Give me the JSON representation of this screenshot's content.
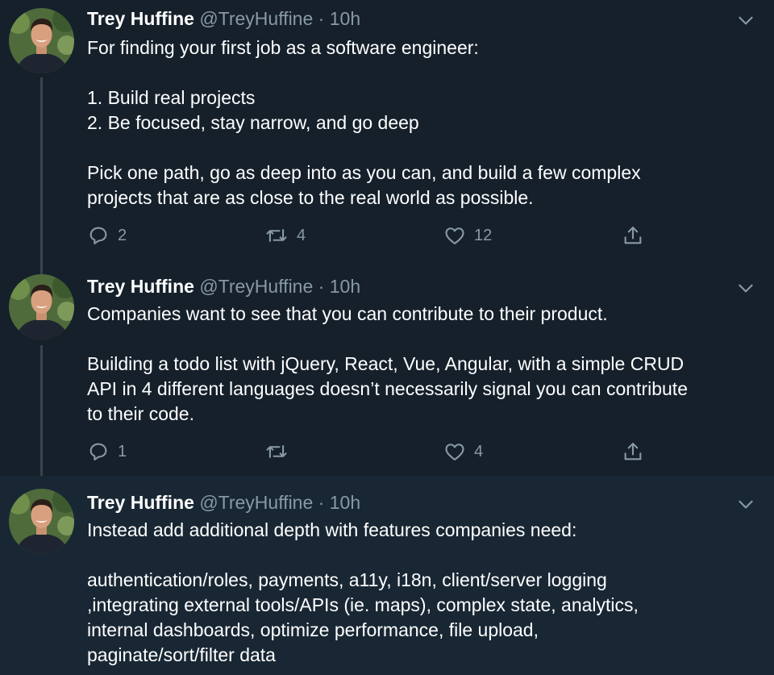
{
  "tweets": [
    {
      "name": "Trey Huffine",
      "handle": "@TreyHuffine",
      "separator": "·",
      "time": "10h",
      "lines": [
        "For finding your first job as a software engineer:",
        "",
        "1. Build real projects",
        "2. Be focused, stay narrow, and go deep",
        "",
        "Pick one path, go as deep into as you can, and build a few complex",
        "projects that are as close to the real world as possible."
      ],
      "replies": "2",
      "retweets": "4",
      "likes": "12"
    },
    {
      "name": "Trey Huffine",
      "handle": "@TreyHuffine",
      "separator": "·",
      "time": "10h",
      "lines": [
        "Companies want to see that you can contribute to their product.",
        "",
        "Building a todo list with jQuery, React, Vue, Angular, with a simple CRUD",
        "API in 4 different languages doesn’t necessarily signal you can contribute",
        "to their code."
      ],
      "replies": "1",
      "retweets": "",
      "likes": "4"
    },
    {
      "name": "Trey Huffine",
      "handle": "@TreyHuffine",
      "separator": "·",
      "time": "10h",
      "lines": [
        "Instead add additional depth with features companies need:",
        "",
        "authentication/roles, payments, a11y, i18n, client/server logging",
        ",integrating external tools/APIs (ie. maps), complex state, analytics,",
        "internal dashboards, optimize performance, file upload,",
        "paginate/sort/filter data"
      ]
    }
  ],
  "icons": {
    "reply": "reply-icon",
    "retweet": "retweet-icon",
    "like": "heart-icon",
    "share": "share-icon",
    "menu": "chevron-down-icon",
    "avatar": "avatar"
  },
  "colors": {
    "background": "#15202b",
    "highlight_background": "#192734",
    "text": "#ffffff",
    "secondary_text": "#8899a6",
    "thread_line": "#38444d"
  }
}
